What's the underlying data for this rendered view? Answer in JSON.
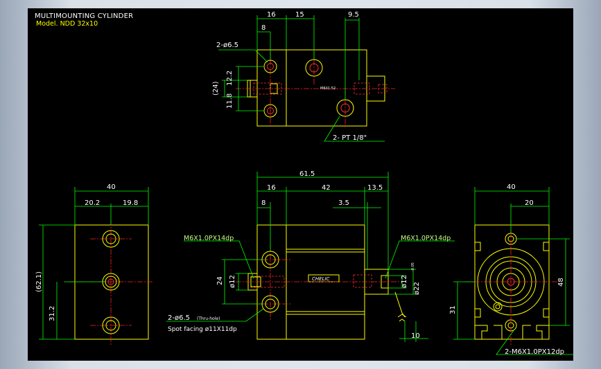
{
  "drawing": {
    "title": "MULTIMOUNTING CYLINDER",
    "model": "Model. NDD 32x10",
    "logo_text": "CHELIC",
    "small_label": "M6X1.52"
  },
  "top_view": {
    "dim_16": "16",
    "dim_15": "15",
    "dim_9_5": "9.5",
    "dim_8": "8",
    "dim_12_2": "12.2",
    "dim_24": "(24)",
    "dim_11_8": "11.8",
    "hole_note": "2-ø6.5",
    "port_note": "2-  PT 1/8\""
  },
  "left_view": {
    "dim_40": "40",
    "dim_20_2": "20.2",
    "dim_19_8": "19.8",
    "dim_62_1": "(62.1)",
    "dim_31_2": "31.2"
  },
  "front_view": {
    "dim_61_5": "61.5",
    "dim_16": "16",
    "dim_42": "42",
    "dim_13_5": "13.5",
    "dim_8": "8",
    "dim_3_5": "3.5",
    "dim_24": "24",
    "dim_phi12_left": "ø12",
    "dim_phi12_right": "ø12",
    "dim_phi22": "ø22",
    "tol_phi22": "-0.05",
    "dim_10": "10",
    "thread_left": "M6X1.0PX14dp",
    "thread_right": "M6X1.0PX14dp",
    "hole_note": "2-ø6.5",
    "hole_note_tail": "(Thru-hole)",
    "spot_facing": "Spot facing  ø11X11dp"
  },
  "right_view": {
    "dim_40": "40",
    "dim_20": "20",
    "dim_48": "48",
    "dim_31": "31",
    "thread_note": "2-M6X1.0PX12dp"
  },
  "colors": {
    "object": "#ffff00",
    "dimension": "#00ff00",
    "center": "#ff2020",
    "text": "#ffffff",
    "background": "#000000"
  }
}
